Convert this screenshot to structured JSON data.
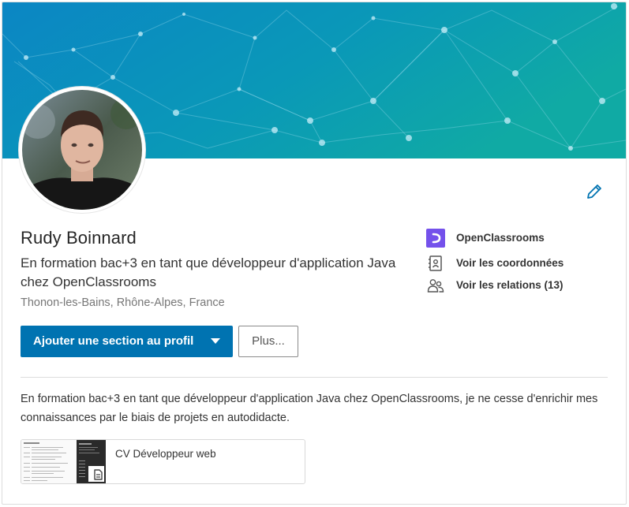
{
  "profile": {
    "name": "Rudy Boinnard",
    "headline": "En formation bac+3 en tant que développeur d'application Java chez OpenClassrooms",
    "location": "Thonon-les-Bains, Rhône-Alpes, France",
    "summary": "En formation bac+3 en tant que développeur d'application Java chez OpenClassrooms, je ne cesse d'enrichir mes connaissances par le biais de projets en autodidacte."
  },
  "actions": {
    "add_section_label": "Ajouter une section au profil",
    "more_label": "Plus..."
  },
  "sidebar": {
    "items": [
      {
        "label": "OpenClassrooms",
        "icon": "openclassrooms-logo-icon"
      },
      {
        "label": "Voir les coordonnées",
        "icon": "contact-card-icon"
      },
      {
        "label": "Voir les relations (13)",
        "icon": "people-icon"
      }
    ]
  },
  "media": {
    "title": "CV Développeur web",
    "icon": "document-icon"
  },
  "colors": {
    "primary": "#0073b1",
    "banner_start": "#0a88c5",
    "banner_end": "#0aa6a0",
    "openclassrooms": "#7451eb"
  }
}
